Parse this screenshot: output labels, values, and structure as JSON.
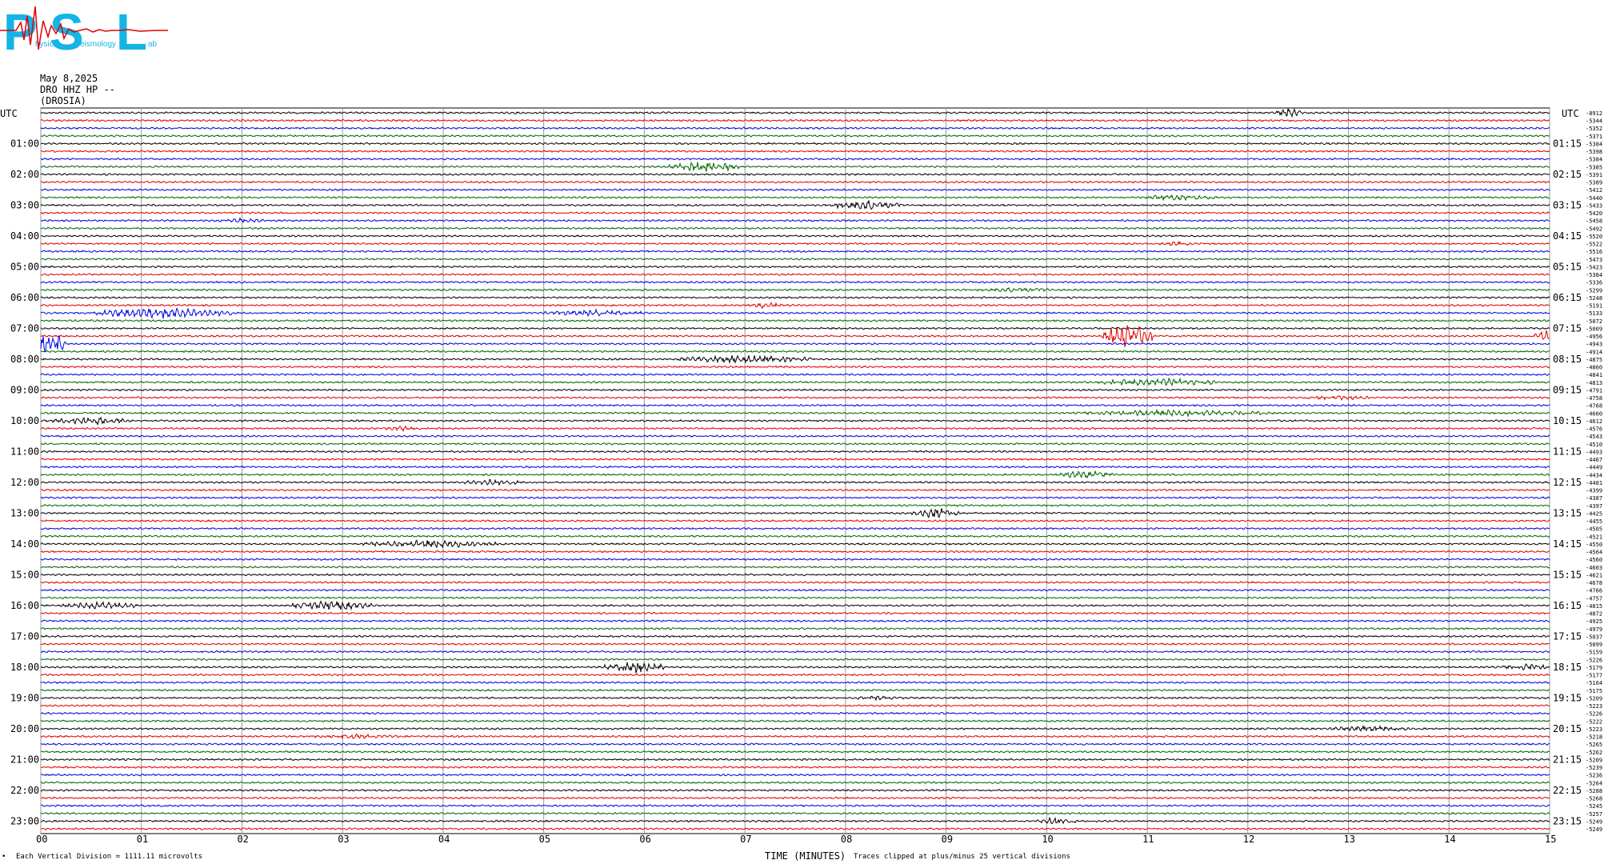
{
  "logo": {
    "letters": [
      "P",
      "S",
      "L"
    ],
    "small_words": [
      "hysics",
      "eismology",
      "ab"
    ]
  },
  "header": {
    "date": "May 8,2025",
    "station": "DRO HHZ HP --",
    "location": "(DROSIA)"
  },
  "left_axis_label": "UTC",
  "right_axis_label": "UTC",
  "footer": {
    "vertical_division": "Each Vertical Division = 1111.11 microvolts",
    "xlabel": "TIME (MINUTES)",
    "clip_note": "Traces clipped at plus/minus 25 vertical divisions",
    "corner_mark": "•"
  },
  "chart_data": {
    "type": "line",
    "title": "",
    "xlabel": "TIME (MINUTES)",
    "xlim": [
      0,
      15
    ],
    "x_ticks": [
      "00",
      "01",
      "02",
      "03",
      "04",
      "05",
      "06",
      "07",
      "08",
      "09",
      "10",
      "11",
      "12",
      "13",
      "14",
      "15"
    ],
    "grid": true,
    "trace_colors": [
      "#000000",
      "#e00000",
      "#0000e0",
      "#006400"
    ],
    "left_hour_labels": [
      "01:00",
      "02:00",
      "03:00",
      "04:00",
      "05:00",
      "06:00",
      "07:00",
      "08:00",
      "09:00",
      "10:00",
      "11:00",
      "12:00",
      "13:00",
      "14:00",
      "15:00",
      "16:00",
      "17:00",
      "18:00",
      "19:00",
      "20:00",
      "21:00",
      "22:00",
      "23:00"
    ],
    "right_hour_labels": [
      "01:15",
      "02:15",
      "03:15",
      "04:15",
      "05:15",
      "06:15",
      "07:15",
      "08:15",
      "09:15",
      "10:15",
      "11:15",
      "12:15",
      "13:15",
      "14:15",
      "15:15",
      "16:15",
      "17:15",
      "18:15",
      "19:15",
      "20:15",
      "21:15",
      "22:15",
      "23:15"
    ],
    "trace_offsets": [
      -8912,
      -5344,
      -5352,
      -5371,
      -5384,
      -5398,
      -5384,
      -5385,
      -5391,
      -5389,
      -5412,
      -5440,
      -5433,
      -5420,
      -5458,
      -5492,
      -5520,
      -5522,
      -5516,
      -5473,
      -5423,
      -5384,
      -5336,
      -5299,
      -5248,
      -5191,
      -5133,
      -5072,
      -5009,
      -4956,
      -4943,
      -4914,
      -4875,
      -4860,
      -4841,
      -4813,
      -4791,
      -4758,
      -4768,
      -4660,
      -4612,
      -4576,
      -4543,
      -4510,
      -4493,
      -4467,
      -4449,
      -4434,
      -4401,
      -4399,
      -4387,
      -4397,
      -4425,
      -4455,
      -4505,
      -4521,
      -4550,
      -4564,
      -4560,
      -4603,
      -4621,
      -4678,
      -4766,
      -4757,
      -4815,
      -4872,
      -4925,
      -4979,
      -5037,
      -5099,
      -5159,
      -5226,
      -5179,
      -5177,
      -5164,
      -5175,
      -5209,
      -5223,
      -5226,
      -5222,
      -5223,
      -5218,
      -5265,
      -5262,
      -5209,
      -5239,
      -5236,
      -5264,
      -5288,
      -5268,
      -5245,
      -5257,
      -5249,
      -5249
    ],
    "events": [
      {
        "trace": 0,
        "minute": 12.4,
        "width_min": 0.25,
        "amp": 6
      },
      {
        "trace": 7,
        "minute": 6.6,
        "width_min": 0.7,
        "amp": 7
      },
      {
        "trace": 11,
        "minute": 11.3,
        "width_min": 0.8,
        "amp": 4
      },
      {
        "trace": 12,
        "minute": 8.2,
        "width_min": 0.7,
        "amp": 6
      },
      {
        "trace": 14,
        "minute": 2.0,
        "width_min": 0.6,
        "amp": 3
      },
      {
        "trace": 17,
        "minute": 11.3,
        "width_min": 0.4,
        "amp": 3
      },
      {
        "trace": 23,
        "minute": 9.7,
        "width_min": 0.8,
        "amp": 3
      },
      {
        "trace": 25,
        "minute": 7.2,
        "width_min": 0.4,
        "amp": 4
      },
      {
        "trace": 26,
        "minute": 1.2,
        "width_min": 1.4,
        "amp": 7
      },
      {
        "trace": 26,
        "minute": 5.5,
        "width_min": 1.0,
        "amp": 4
      },
      {
        "trace": 29,
        "minute": 10.8,
        "width_min": 0.5,
        "amp": 16
      },
      {
        "trace": 29,
        "minute": 15.0,
        "width_min": 0.3,
        "amp": 8
      },
      {
        "trace": 30,
        "minute": 0.1,
        "width_min": 0.3,
        "amp": 14
      },
      {
        "trace": 32,
        "minute": 7.0,
        "width_min": 1.4,
        "amp": 5
      },
      {
        "trace": 35,
        "minute": 11.1,
        "width_min": 1.2,
        "amp": 5
      },
      {
        "trace": 37,
        "minute": 12.9,
        "width_min": 0.8,
        "amp": 3
      },
      {
        "trace": 39,
        "minute": 11.3,
        "width_min": 2.0,
        "amp": 4
      },
      {
        "trace": 40,
        "minute": 0.5,
        "width_min": 0.8,
        "amp": 5
      },
      {
        "trace": 41,
        "minute": 3.6,
        "width_min": 0.4,
        "amp": 3
      },
      {
        "trace": 47,
        "minute": 10.4,
        "width_min": 0.6,
        "amp": 5
      },
      {
        "trace": 48,
        "minute": 4.5,
        "width_min": 0.6,
        "amp": 4
      },
      {
        "trace": 52,
        "minute": 8.9,
        "width_min": 0.5,
        "amp": 7
      },
      {
        "trace": 56,
        "minute": 3.9,
        "width_min": 1.4,
        "amp": 5
      },
      {
        "trace": 64,
        "minute": 0.6,
        "width_min": 0.8,
        "amp": 5
      },
      {
        "trace": 64,
        "minute": 2.9,
        "width_min": 0.8,
        "amp": 6
      },
      {
        "trace": 72,
        "minute": 5.9,
        "width_min": 0.6,
        "amp": 8
      },
      {
        "trace": 72,
        "minute": 14.8,
        "width_min": 0.6,
        "amp": 4
      },
      {
        "trace": 76,
        "minute": 8.3,
        "width_min": 0.4,
        "amp": 3
      },
      {
        "trace": 80,
        "minute": 13.2,
        "width_min": 0.8,
        "amp": 4
      },
      {
        "trace": 81,
        "minute": 3.1,
        "width_min": 1.0,
        "amp": 3
      },
      {
        "trace": 92,
        "minute": 10.1,
        "width_min": 0.4,
        "amp": 5
      }
    ]
  }
}
